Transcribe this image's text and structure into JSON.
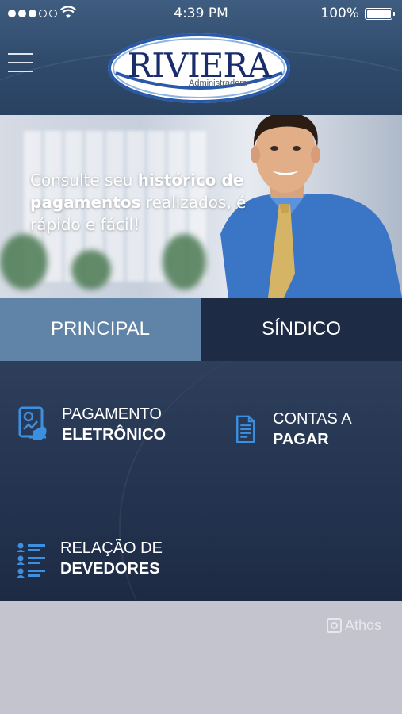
{
  "status_bar": {
    "time": "4:39 PM",
    "battery_percent": "100%",
    "signal_bars_filled": 3,
    "signal_bars_total": 5
  },
  "header": {
    "logo_title": "RIVIERA",
    "logo_subtitle": "Administradora",
    "menu_icon": "hamburger-menu-icon"
  },
  "hero": {
    "text_part1": "Consulte seu ",
    "text_bold": "histórico de pagamentos",
    "text_part2": " realizados, é rápido e fácil!"
  },
  "tabs": [
    {
      "label": "PRINCIPAL",
      "active": true
    },
    {
      "label": "SÍNDICO",
      "active": false
    }
  ],
  "menu": {
    "pagamento": {
      "line1": "PAGAMENTO",
      "line2": "ELETRÔNICO",
      "icon": "payment-device-icon"
    },
    "contas": {
      "line1": "CONTAS A",
      "line2": "PAGAR",
      "icon": "document-icon"
    },
    "relacao": {
      "line1": "RELAÇÃO DE",
      "line2": "DEVEDORES",
      "icon": "debtors-list-icon"
    }
  },
  "footer": {
    "brand": "Athos"
  },
  "colors": {
    "header": "#2f4a6b",
    "tab_active": "#5f84a8",
    "tab_inactive": "#1e2b44",
    "panel": "#243450",
    "icon_blue": "#3d8fe0",
    "footer": "#c3c4cd",
    "logo_navy": "#1a2d6b"
  }
}
